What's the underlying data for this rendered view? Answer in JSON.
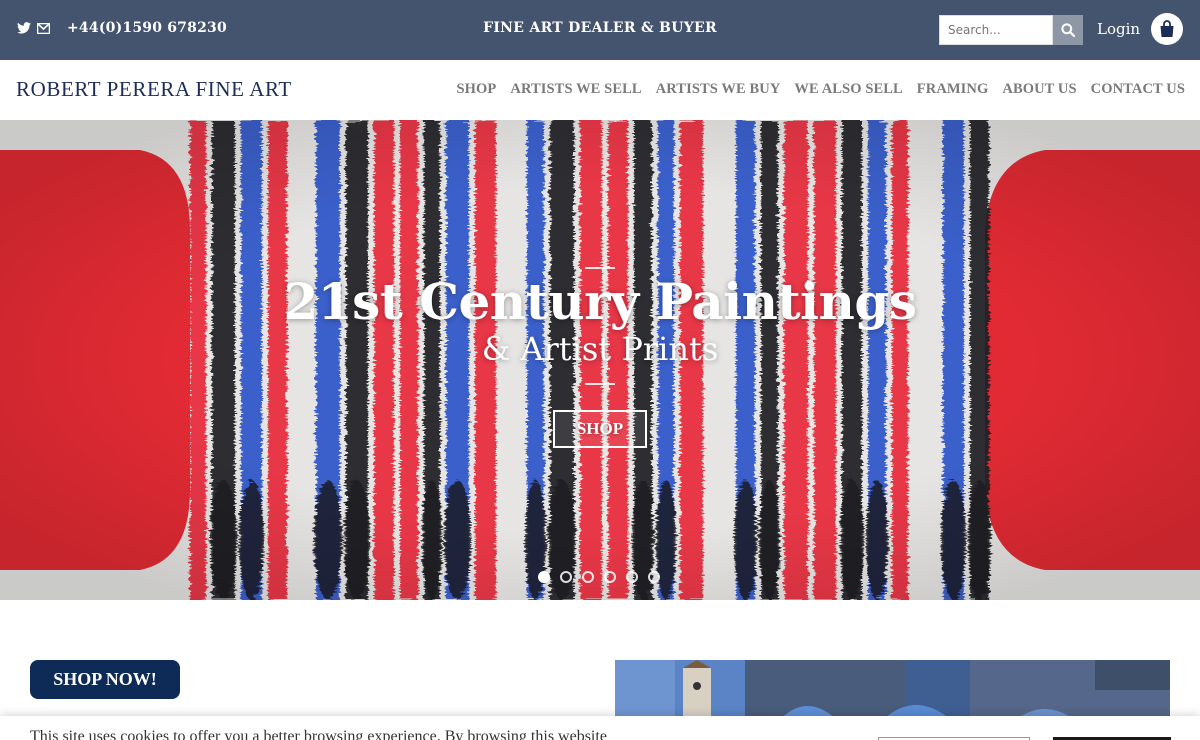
{
  "topbar": {
    "social_icons": [
      "twitter-icon",
      "envelope-icon"
    ],
    "phone": "+44(0)1590 678230",
    "tagline": "FINE ART DEALER & BUYER",
    "search_placeholder": "Search...",
    "login": "Login",
    "cart_icon": "shopping-bag-icon"
  },
  "header": {
    "logo": "ROBERT PERERA FINE ART",
    "nav": [
      "SHOP",
      "ARTISTS WE SELL",
      "ARTISTS WE BUY",
      "WE ALSO SELL",
      "FRAMING",
      "ABOUT US",
      "CONTACT US"
    ]
  },
  "hero": {
    "title": "21st Century Paintings",
    "subtitle": "& Artist Prints",
    "button": "SHOP",
    "slides_total": 6,
    "active_slide": 1
  },
  "content": {
    "shop_now": "SHOP NOW!"
  },
  "cookie": {
    "text": "This site uses cookies to offer you a better browsing experience. By browsing this website"
  },
  "colors": {
    "topbar": "#44546f",
    "brand_navy": "#1c2d57",
    "button_navy": "#0e2a57",
    "nav_text": "#7a7a7a"
  }
}
